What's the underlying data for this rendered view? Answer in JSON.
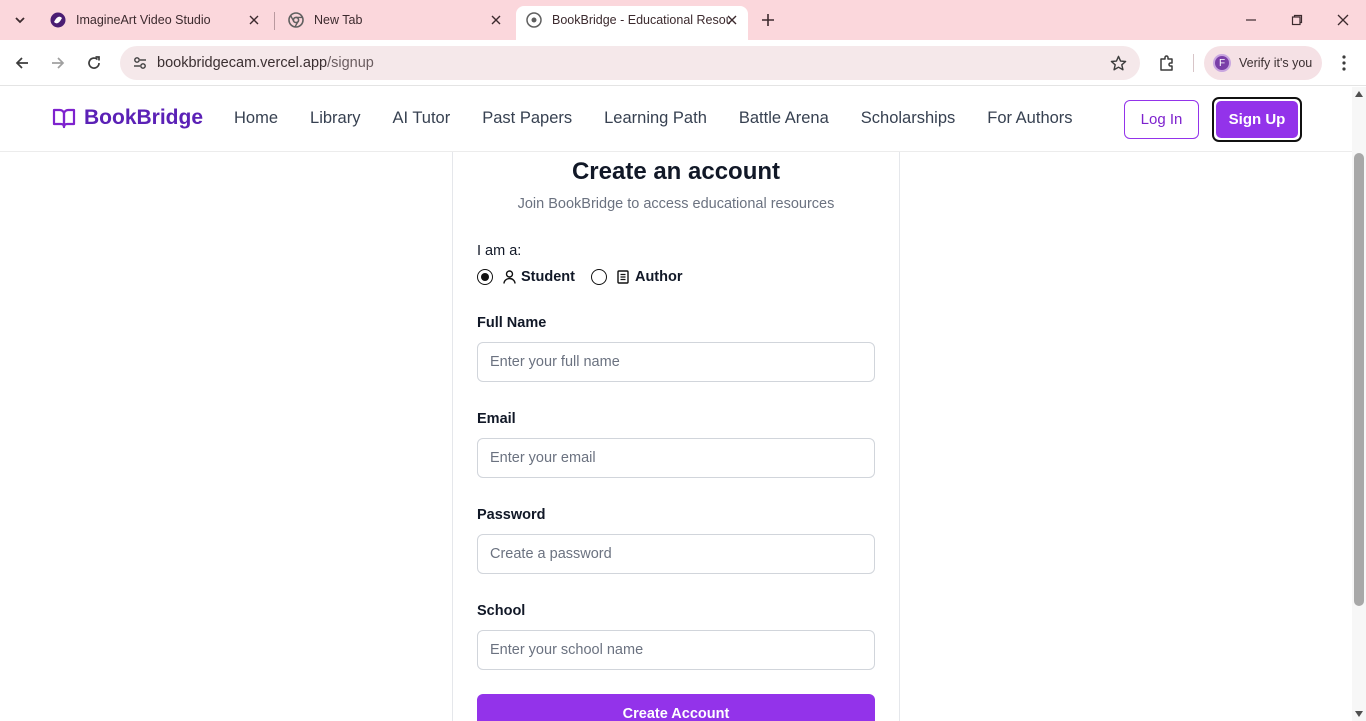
{
  "browser": {
    "tabs": [
      {
        "title": "ImagineArt Video Studio"
      },
      {
        "title": "New Tab"
      },
      {
        "title": "BookBridge - Educational Resou"
      }
    ],
    "url_host": "bookbridgecam.vercel.app",
    "url_path": "/signup",
    "profile_initial": "F",
    "profile_label": "Verify it's you"
  },
  "site": {
    "brand": "BookBridge",
    "nav": [
      "Home",
      "Library",
      "AI Tutor",
      "Past Papers",
      "Learning Path",
      "Battle Arena",
      "Scholarships",
      "For Authors"
    ],
    "login_label": "Log In",
    "signup_label": "Sign Up",
    "accent_color": "#9333ea"
  },
  "form": {
    "title": "Create an account",
    "subtitle": "Join BookBridge to access educational resources",
    "role_label": "I am a:",
    "roles": [
      {
        "label": "Student",
        "selected": true,
        "icon": "user-icon"
      },
      {
        "label": "Author",
        "selected": false,
        "icon": "book-icon"
      }
    ],
    "fields": [
      {
        "label": "Full Name",
        "placeholder": "Enter your full name",
        "value": ""
      },
      {
        "label": "Email",
        "placeholder": "Enter your email",
        "value": ""
      },
      {
        "label": "Password",
        "placeholder": "Create a password",
        "value": ""
      },
      {
        "label": "School",
        "placeholder": "Enter your school name",
        "value": ""
      }
    ],
    "submit_label": "Create Account"
  }
}
